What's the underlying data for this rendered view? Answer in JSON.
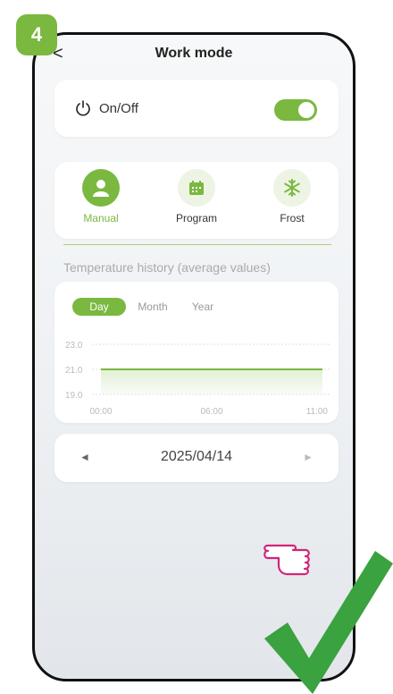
{
  "step_number": "4",
  "header": {
    "back_glyph": "<",
    "title": "Work mode"
  },
  "power": {
    "label": "On/Off",
    "state": true,
    "icon": "power-icon"
  },
  "modes": [
    {
      "label": "Manual",
      "icon": "person-icon",
      "active": true
    },
    {
      "label": "Program",
      "icon": "calendar-icon",
      "active": false
    },
    {
      "label": "Frost",
      "icon": "snowflake-icon",
      "active": false
    }
  ],
  "history": {
    "title": "Temperature history (average values)",
    "tabs": [
      "Day",
      "Month",
      "Year"
    ],
    "active_tab": "Day"
  },
  "chart_data": {
    "type": "area",
    "x": [
      "00:00",
      "06:00",
      "11:00"
    ],
    "series": [
      {
        "values": [
          21.0,
          21.0,
          21.0
        ]
      }
    ],
    "yticks": [
      "23.0",
      "21.0",
      "19.0"
    ],
    "ylim": [
      19.0,
      23.0
    ],
    "grid": true,
    "color": "#7ab840"
  },
  "date_nav": {
    "prev": "◄",
    "date": "2025/04/14",
    "next": "►"
  },
  "accent_color": "#7ab840"
}
